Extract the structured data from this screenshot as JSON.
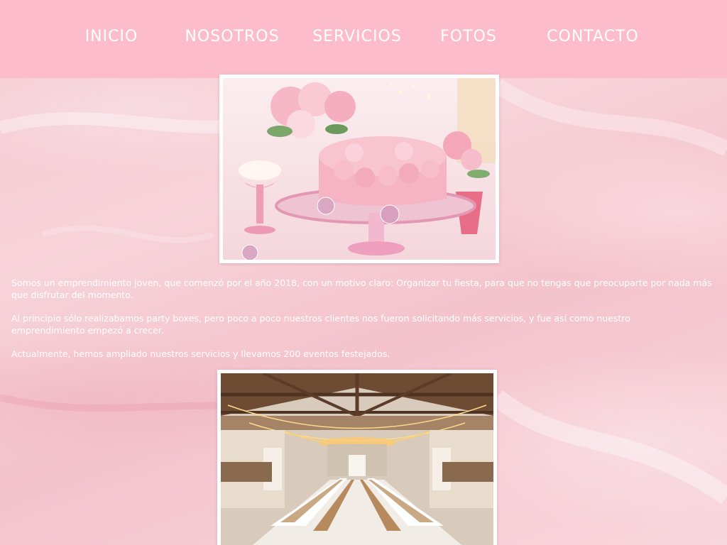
{
  "nav": {
    "items": [
      {
        "label": "INICIO"
      },
      {
        "label": "NOSOTROS"
      },
      {
        "label": "SERVICIOS"
      },
      {
        "label": "FOTOS"
      },
      {
        "label": "CONTACTO"
      }
    ]
  },
  "about": {
    "paragraphs": [
      "Somos un emprendimiento joven, que comenzó por el año 2018, con un motivo claro: Organizar tu fiesta, para que no tengas que preocuparte por nada más que disfrutar del momento.",
      "Al principio sólo realizabamos party boxes, pero poco a poco nuestros clientes nos fueron solicitando más servicios, y fue así como nuestro emprendimiento empezó a crecer.",
      "Actualmente, hemos ampliado nuestros servicios y llevamos 200 eventos festejados."
    ]
  },
  "colors": {
    "navbar": "#fdbccb",
    "background": "#f5ccd4",
    "text": "#ffffff"
  }
}
